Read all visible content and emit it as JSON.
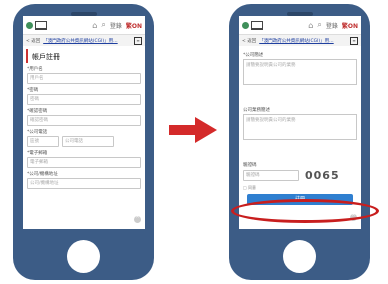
{
  "app": {
    "nav_home_label": "",
    "nav_search_label": "",
    "nav_lang_label": "繁ON",
    "nav_extra_label": "登錄",
    "back_label": "< 返回",
    "breadcrumb": "「澳門政府公共資訊網站(CGI)」用…",
    "menu_icon": "menu-icon"
  },
  "left_screen": {
    "form_title": "帳戶註冊",
    "fields": [
      {
        "label": "*用戶名",
        "placeholder": "用戶名"
      },
      {
        "label": "*密碼",
        "placeholder": "密碼"
      },
      {
        "label": "*確認密碼",
        "placeholder": "確認密碼"
      },
      {
        "label": "*公司電話",
        "placeholder_a": "區號",
        "placeholder_b": "公司電話"
      },
      {
        "label": "*電子郵箱",
        "placeholder": "電子郵箱"
      },
      {
        "label": "*公司/機構地址",
        "placeholder": "公司/機構地址"
      }
    ]
  },
  "right_screen": {
    "sections": [
      {
        "label": "*公司簡述",
        "placeholder": "請簡要說明貴公司的業務"
      },
      {
        "label": "公司業務簡述",
        "placeholder": "請簡要說明貴公司的業務"
      }
    ],
    "captcha_label": "驗證碼",
    "captcha_placeholder": "驗證碼",
    "captcha_code": "0065",
    "agree_text": "□ 同意",
    "submit_label": "註冊"
  },
  "colors": {
    "phone_body": "#3c5c86",
    "arrow": "#d42a2a",
    "highlight_ring": "#c81e1e",
    "submit_button": "#2f7fd0"
  }
}
